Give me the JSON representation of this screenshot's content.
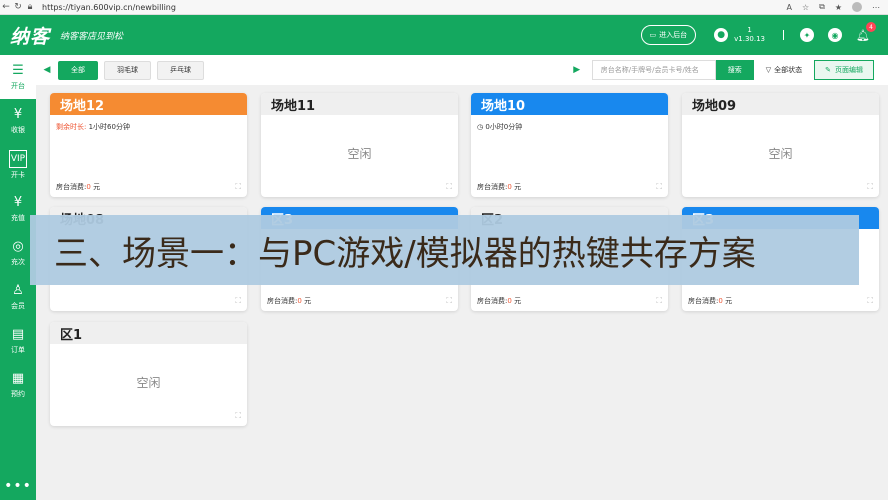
{
  "browser": {
    "url": "https://tiyan.600vip.cn/newbilling"
  },
  "header": {
    "logo": "纳客",
    "slogan": "纳客客店见到松",
    "enter_backend": "进入后台",
    "user_id": "1",
    "version": "v1.30.13",
    "notification_count": "4",
    "brand_color": "#14a85f"
  },
  "sidebar": {
    "items": [
      {
        "label": "开台",
        "icon": "open-table-icon",
        "glyph": "☰"
      },
      {
        "label": "收银",
        "icon": "cashier-icon",
        "glyph": "¥"
      },
      {
        "label": "开卡",
        "icon": "vip-card-icon",
        "glyph": "VIP"
      },
      {
        "label": "充值",
        "icon": "recharge-icon",
        "glyph": "¥"
      },
      {
        "label": "充次",
        "icon": "recharge-times-icon",
        "glyph": "◎"
      },
      {
        "label": "会员",
        "icon": "member-icon",
        "glyph": "♙"
      },
      {
        "label": "订单",
        "icon": "order-icon",
        "glyph": "▤"
      },
      {
        "label": "预约",
        "icon": "reservation-icon",
        "glyph": "▦"
      }
    ],
    "more": "•••"
  },
  "toolbar": {
    "tabs": [
      "全部",
      "羽毛球",
      "乒乓球"
    ],
    "search_placeholder": "房台名称/手牌号/会员卡号/姓名",
    "search_button": "搜索",
    "status_filter": "全部状态",
    "edit_button": "页面编辑"
  },
  "cards": [
    {
      "name": "场地12",
      "style": "orange",
      "line_label": "剩余时长:",
      "line_value": "1小时60分钟",
      "fee_label": "房台消费:",
      "fee_value": "0",
      "fee_unit": "元"
    },
    {
      "name": "场地11",
      "style": "grey",
      "empty": "空闲"
    },
    {
      "name": "场地10",
      "style": "blue",
      "line_label": "",
      "line_value": "0小时0分钟",
      "fee_label": "房台消费:",
      "fee_value": "0",
      "fee_unit": "元"
    },
    {
      "name": "场地09",
      "style": "grey",
      "empty": "空闲"
    },
    {
      "name": "场地08",
      "style": "grey",
      "fee_label": "",
      "fee_value": "",
      "fee_unit": ""
    },
    {
      "name": "区3",
      "style": "blue",
      "fee_label": "房台消费:",
      "fee_value": "0",
      "fee_unit": "元"
    },
    {
      "name": "区2",
      "style": "grey",
      "fee_label": "房台消费:",
      "fee_value": "0",
      "fee_unit": "元"
    },
    {
      "name": "区3",
      "style": "blue",
      "fee_label": "房台消费:",
      "fee_value": "0",
      "fee_unit": "元"
    },
    {
      "name": "区1",
      "style": "grey",
      "empty": "空闲"
    }
  ],
  "banner": {
    "text": "三、场景一：与PC游戏/模拟器的热键共存方案"
  }
}
